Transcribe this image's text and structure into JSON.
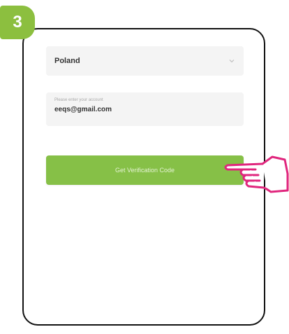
{
  "step": {
    "number": "3"
  },
  "form": {
    "country": {
      "value": "Poland"
    },
    "account": {
      "placeholder": "Please enter your account",
      "value": "eeqs@gmail.com"
    },
    "verify_button": {
      "label": "Get Verification Code"
    }
  },
  "colors": {
    "accent_green": "#8cbf3f",
    "button_green": "#86c047",
    "hand_outline": "#e0267d",
    "frame": "#111111"
  },
  "icons": {
    "chevron": "chevron-down-icon",
    "pointer": "pointing-hand-icon"
  }
}
